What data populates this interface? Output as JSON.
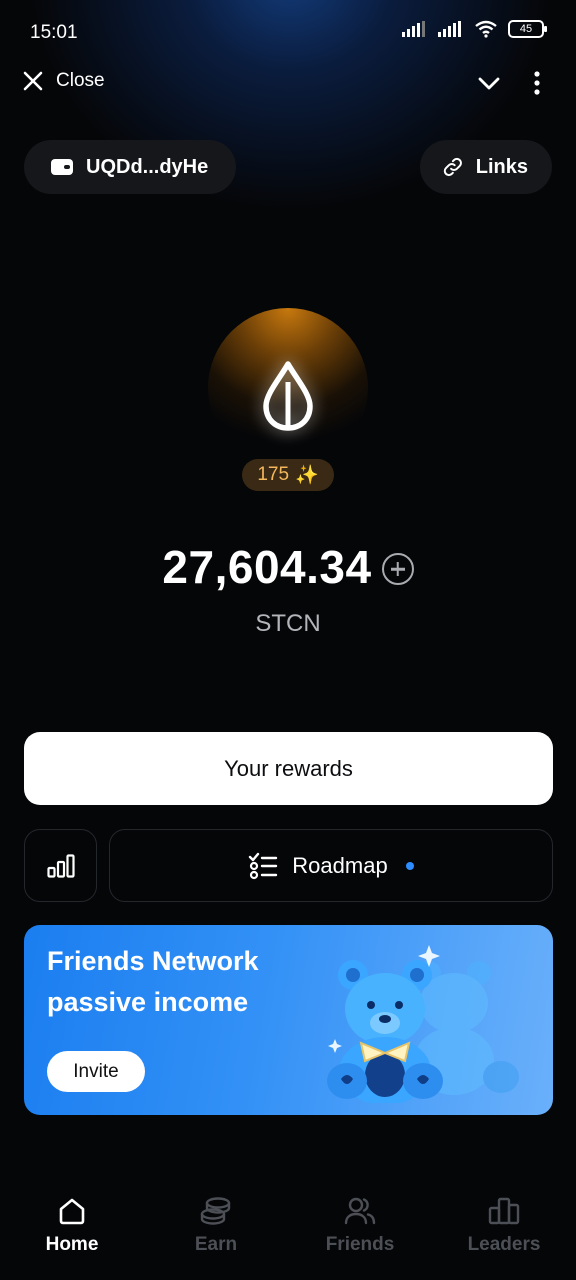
{
  "status_bar": {
    "time": "15:01",
    "battery": "45"
  },
  "topbar": {
    "close_label": "Close"
  },
  "wallet": {
    "address": "UQDd...dyHe"
  },
  "links": {
    "label": "Links"
  },
  "token": {
    "stars": "175"
  },
  "balance": {
    "amount": "27,604.34",
    "currency": "STCN"
  },
  "actions": {
    "rewards_label": "Your rewards",
    "roadmap_label": "Roadmap"
  },
  "banner": {
    "title": "Friends Network passive income",
    "invite_label": "Invite"
  },
  "nav": [
    {
      "label": "Home",
      "icon": "home-icon",
      "active": true
    },
    {
      "label": "Earn",
      "icon": "coins-icon",
      "active": false
    },
    {
      "label": "Friends",
      "icon": "friends-icon",
      "active": false
    },
    {
      "label": "Leaders",
      "icon": "leaders-icon",
      "active": false
    }
  ],
  "colors": {
    "accent_blue": "#2d8cff",
    "stars_gold": "#f3b75c",
    "background": "#050608"
  }
}
